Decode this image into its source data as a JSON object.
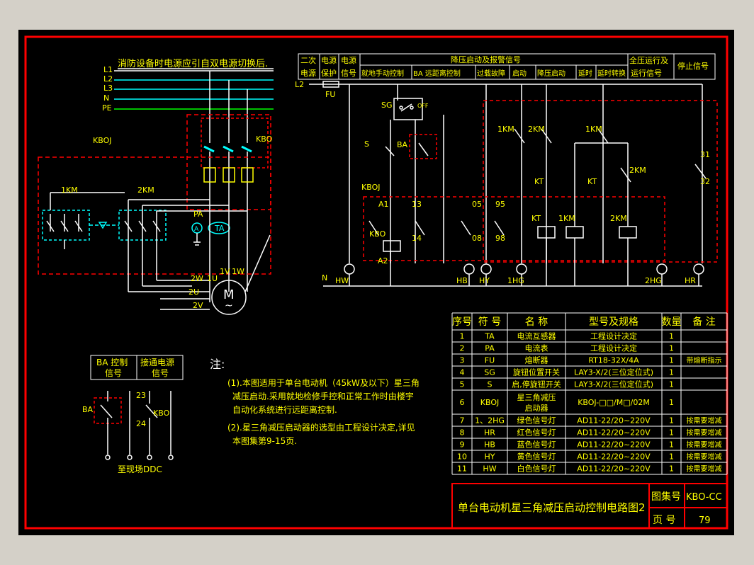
{
  "colors": {
    "frame": "#ff0000",
    "wire": "#ffffff",
    "border": "#ff00ff",
    "text": "#ffff00",
    "accent_cyan": "#00ffff",
    "accent_green": "#00ff00",
    "dashed": "#ff0000"
  },
  "power": {
    "header": "消防设备时电源应引自双电源切换后.",
    "lines": [
      "L1",
      "L2",
      "L3",
      "N",
      "PE"
    ],
    "kboj": "KBOJ",
    "kbo": "KBO",
    "km1": "1KM",
    "km2": "2KM",
    "pa": "PA",
    "ta": "TA",
    "a_meter": "A",
    "motor": "M",
    "motor_sub": "~",
    "terminals": {
      "w2": "2W",
      "u2": "2U",
      "v2": "2V",
      "u1": "1U",
      "v1": "1V",
      "w1": "1W"
    }
  },
  "control": {
    "header_cells": [
      "二次\n电源",
      "电源\n保护",
      "电源\n信号",
      "就地手动控制",
      "BA 远距离控制",
      "过载故障",
      "启动",
      "降压启动",
      "延时",
      "延时转换",
      "全压运行及\n运行信号",
      "停止信号"
    ],
    "header_top": [
      "二次",
      "电源",
      "电源",
      "降压启动及报警信号",
      "全压运行及"
    ],
    "header_bottom": [
      "电源",
      "保护",
      "信号",
      "就地手动控制",
      "BA 远距离控制",
      "过载故障",
      "启动",
      "降压启动",
      "延时",
      "延时转换",
      "运行信号",
      "停止信号"
    ],
    "l2": "L2",
    "fu": "FU",
    "sg": "SG",
    "off": "OFF",
    "s": "S",
    "ba": "BA",
    "kboj": "KBOJ",
    "terminals": [
      "A1",
      "13",
      "05",
      "95",
      "14",
      "08",
      "98",
      "A2",
      "31",
      "32"
    ],
    "kbo": "KBO",
    "contacts": [
      "1KM",
      "2KM",
      "1KM",
      "KT",
      "KT",
      "2KM"
    ],
    "coils": [
      "KT",
      "1KM",
      "2KM"
    ],
    "n": "N",
    "lamps": [
      "HW",
      "HB",
      "HY",
      "1HG",
      "2HG",
      "HR"
    ]
  },
  "ba_box": {
    "col1": "BA 控制\n信号",
    "col1_a": "BA 控制",
    "col1_b": "信号",
    "col2_a": "接通电源",
    "col2_b": "信号",
    "ba": "BA",
    "kbo": "KBO",
    "t23": "23",
    "t24": "24",
    "footer": "至现场DDC"
  },
  "notes": {
    "title": "注:",
    "lines": [
      "(1).本图适用于单台电动机（45kW及以下）星三角",
      "减压启动.采用就地检修手控和正常工作时由楼宇",
      "自动化系统进行远距离控制.",
      "(2).星三角减压启动器的选型由工程设计决定,详见",
      "本图集第9-15页."
    ]
  },
  "table": {
    "headers": [
      "序号",
      "符 号",
      "名 称",
      "型号及规格",
      "数量",
      "备 注"
    ],
    "rows": [
      [
        "1",
        "TA",
        "电流互感器",
        "工程设计决定",
        "1",
        ""
      ],
      [
        "2",
        "PA",
        "电流表",
        "工程设计决定",
        "1",
        ""
      ],
      [
        "3",
        "FU",
        "熔断器",
        "RT18-32X/4A",
        "1",
        "带熔断指示"
      ],
      [
        "4",
        "SG",
        "旋钮位置开关",
        "LAY3-X/2(三位定位式)",
        "1",
        ""
      ],
      [
        "5",
        "S",
        "启,停旋钮开关",
        "LAY3-X/2(三位定位式)",
        "1",
        ""
      ],
      [
        "6",
        "KBOJ",
        "星三角减压\n启动器",
        "KBOJ-□□/M□/02M",
        "1",
        ""
      ],
      [
        "7",
        "1、2HG",
        "绿色信号灯",
        "AD11-22/20~220V",
        "1",
        "按需要增减"
      ],
      [
        "8",
        "HR",
        "红色信号灯",
        "AD11-22/20~220V",
        "1",
        "按需要增减"
      ],
      [
        "9",
        "HB",
        "蓝色信号灯",
        "AD11-22/20~220V",
        "1",
        "按需要增减"
      ],
      [
        "10",
        "HY",
        "黄色信号灯",
        "AD11-22/20~220V",
        "1",
        "按需要增减"
      ],
      [
        "11",
        "HW",
        "白色信号灯",
        "AD11-22/20~220V",
        "1",
        "按需要增减"
      ]
    ],
    "row6_name_a": "星三角减压",
    "row6_name_b": "启动器"
  },
  "title_block": {
    "title": "单台电动机星三角减压启动控制电路图2",
    "atlas_label": "图集号",
    "atlas_value": "KBO-CC",
    "page_label": "页 号",
    "page_value": "79"
  }
}
